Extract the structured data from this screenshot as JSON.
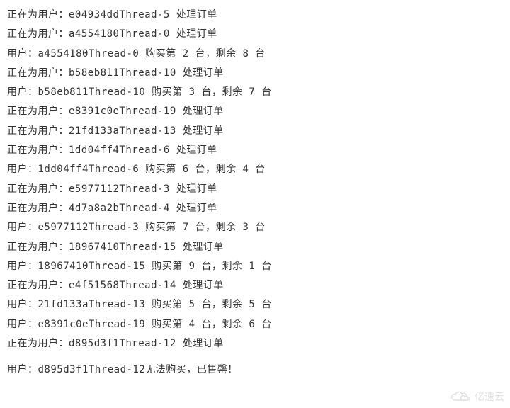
{
  "log_lines": [
    "正在为用户：e04934ddThread-5 处理订单",
    "正在为用户：a4554180Thread-0 处理订单",
    "用户：a4554180Thread-0 购买第 2 台，剩余 8 台",
    "正在为用户：b58eb811Thread-10 处理订单",
    "用户：b58eb811Thread-10 购买第 3 台，剩余 7 台",
    "正在为用户：e8391c0eThread-19 处理订单",
    "正在为用户：21fd133aThread-13 处理订单",
    "正在为用户：1dd04ff4Thread-6 处理订单",
    "用户：1dd04ff4Thread-6 购买第 6 台，剩余 4 台",
    "正在为用户：e5977112Thread-3 处理订单",
    "正在为用户：4d7a8a2bThread-4 处理订单",
    "用户：e5977112Thread-3 购买第 7 台，剩余 3 台",
    "正在为用户：18967410Thread-15 处理订单",
    "用户：18967410Thread-15 购买第 9 台，剩余 1 台",
    "正在为用户：e4f51568Thread-14 处理订单",
    "用户：21fd133aThread-13 购买第 5 台，剩余 5 台",
    "用户：e8391c0eThread-19 购买第 4 台，剩余 6 台",
    "正在为用户：d895d3f1Thread-12 处理订单"
  ],
  "final_line": "用户：d895d3f1Thread-12无法购买，已售罄！",
  "watermark": {
    "text": "亿速云"
  }
}
